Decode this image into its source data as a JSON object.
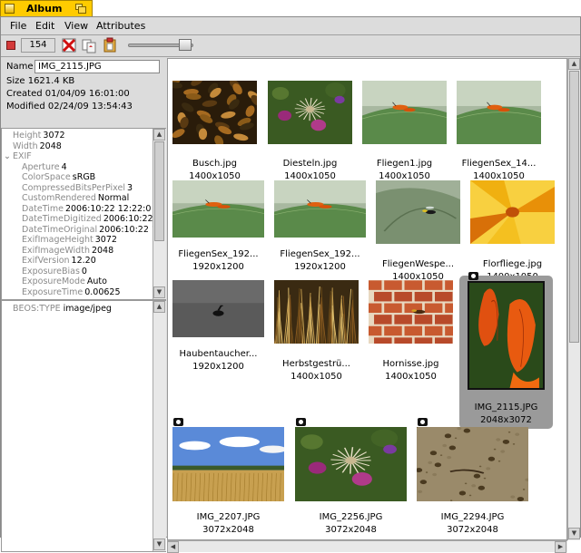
{
  "window": {
    "title": "Album"
  },
  "menu": [
    "File",
    "Edit",
    "View",
    "Attributes"
  ],
  "toolbar": {
    "count": "154"
  },
  "info": {
    "name_label": "Name",
    "name_value": "IMG_2115.JPG",
    "size": "Size 1621.4 KB",
    "created": "Created 01/04/09 16:01:00",
    "modified": "Modified 02/24/09 13:54:43"
  },
  "attributes": [
    {
      "key": "Height",
      "value": "3072",
      "indent": 1
    },
    {
      "key": "Width",
      "value": "2048",
      "indent": 1
    },
    {
      "key": "EXIF",
      "value": "",
      "indent": 0,
      "expand": "⌄"
    },
    {
      "key": "Aperture",
      "value": "4",
      "indent": 2
    },
    {
      "key": "ColorSpace",
      "value": "sRGB",
      "indent": 2
    },
    {
      "key": "CompressedBitsPerPixel",
      "value": "3",
      "indent": 2
    },
    {
      "key": "CustomRendered",
      "value": "Normal",
      "indent": 2
    },
    {
      "key": "DateTime",
      "value": "2006:10:22 12:22:0",
      "indent": 2
    },
    {
      "key": "DateTimeDigitized",
      "value": "2006:10:22",
      "indent": 2
    },
    {
      "key": "DateTimeOriginal",
      "value": "2006:10:22 1",
      "indent": 2
    },
    {
      "key": "ExifImageHeight",
      "value": "3072",
      "indent": 2
    },
    {
      "key": "ExifImageWidth",
      "value": "2048",
      "indent": 2
    },
    {
      "key": "ExifVersion",
      "value": "12.20",
      "indent": 2
    },
    {
      "key": "ExposureBias",
      "value": "0",
      "indent": 2
    },
    {
      "key": "ExposureMode",
      "value": "Auto",
      "indent": 2
    },
    {
      "key": "ExposureTime",
      "value": "0.00625",
      "indent": 2
    }
  ],
  "type_attr": {
    "key": "BEOS:TYPE",
    "value": "image/jpeg"
  },
  "thumbnails": [
    {
      "name": "Busch.jpg",
      "dims": "1400x1050",
      "scene": "leaves"
    },
    {
      "name": "Diesteln.jpg",
      "dims": "1400x1050",
      "scene": "thistle"
    },
    {
      "name": "Fliegen1.jpg",
      "dims": "1400x1050",
      "scene": "fly-leaf"
    },
    {
      "name": "FliegenSex_14...",
      "dims": "1400x1050",
      "scene": "fly-leaf"
    },
    {
      "name": "FliegenSex_192...",
      "dims": "1920x1200",
      "scene": "fly-leaf-wide"
    },
    {
      "name": "FliegenSex_192...",
      "dims": "1920x1200",
      "scene": "fly-leaf-wide"
    },
    {
      "name": "FliegenWespe...",
      "dims": "1400x1050",
      "scene": "wasp"
    },
    {
      "name": "Florfliege.jpg",
      "dims": "1400x1050",
      "scene": "flower-orange"
    },
    {
      "name": "Haubentaucher...",
      "dims": "1920x1200",
      "scene": "lake-bird"
    },
    {
      "name": "Herbstgestrü...",
      "dims": "1400x1050",
      "scene": "autumn-grass"
    },
    {
      "name": "Hornisse.jpg",
      "dims": "1400x1050",
      "scene": "bricks"
    },
    {
      "name": "IMG_2115.JPG",
      "dims": "2048x3072",
      "scene": "physalis",
      "selected": true
    },
    {
      "name": "IMG_2207.JPG",
      "dims": "3072x2048",
      "scene": "field-sky"
    },
    {
      "name": "IMG_2256.JPG",
      "dims": "3072x2048",
      "scene": "thistle-wide"
    },
    {
      "name": "IMG_2294.JPG",
      "dims": "3072x2048",
      "scene": "ground"
    }
  ],
  "colors": {
    "title_tab": "#ffcb00",
    "panel_bg": "#dcdcdc",
    "selection_bg": "#9a9a9a"
  }
}
